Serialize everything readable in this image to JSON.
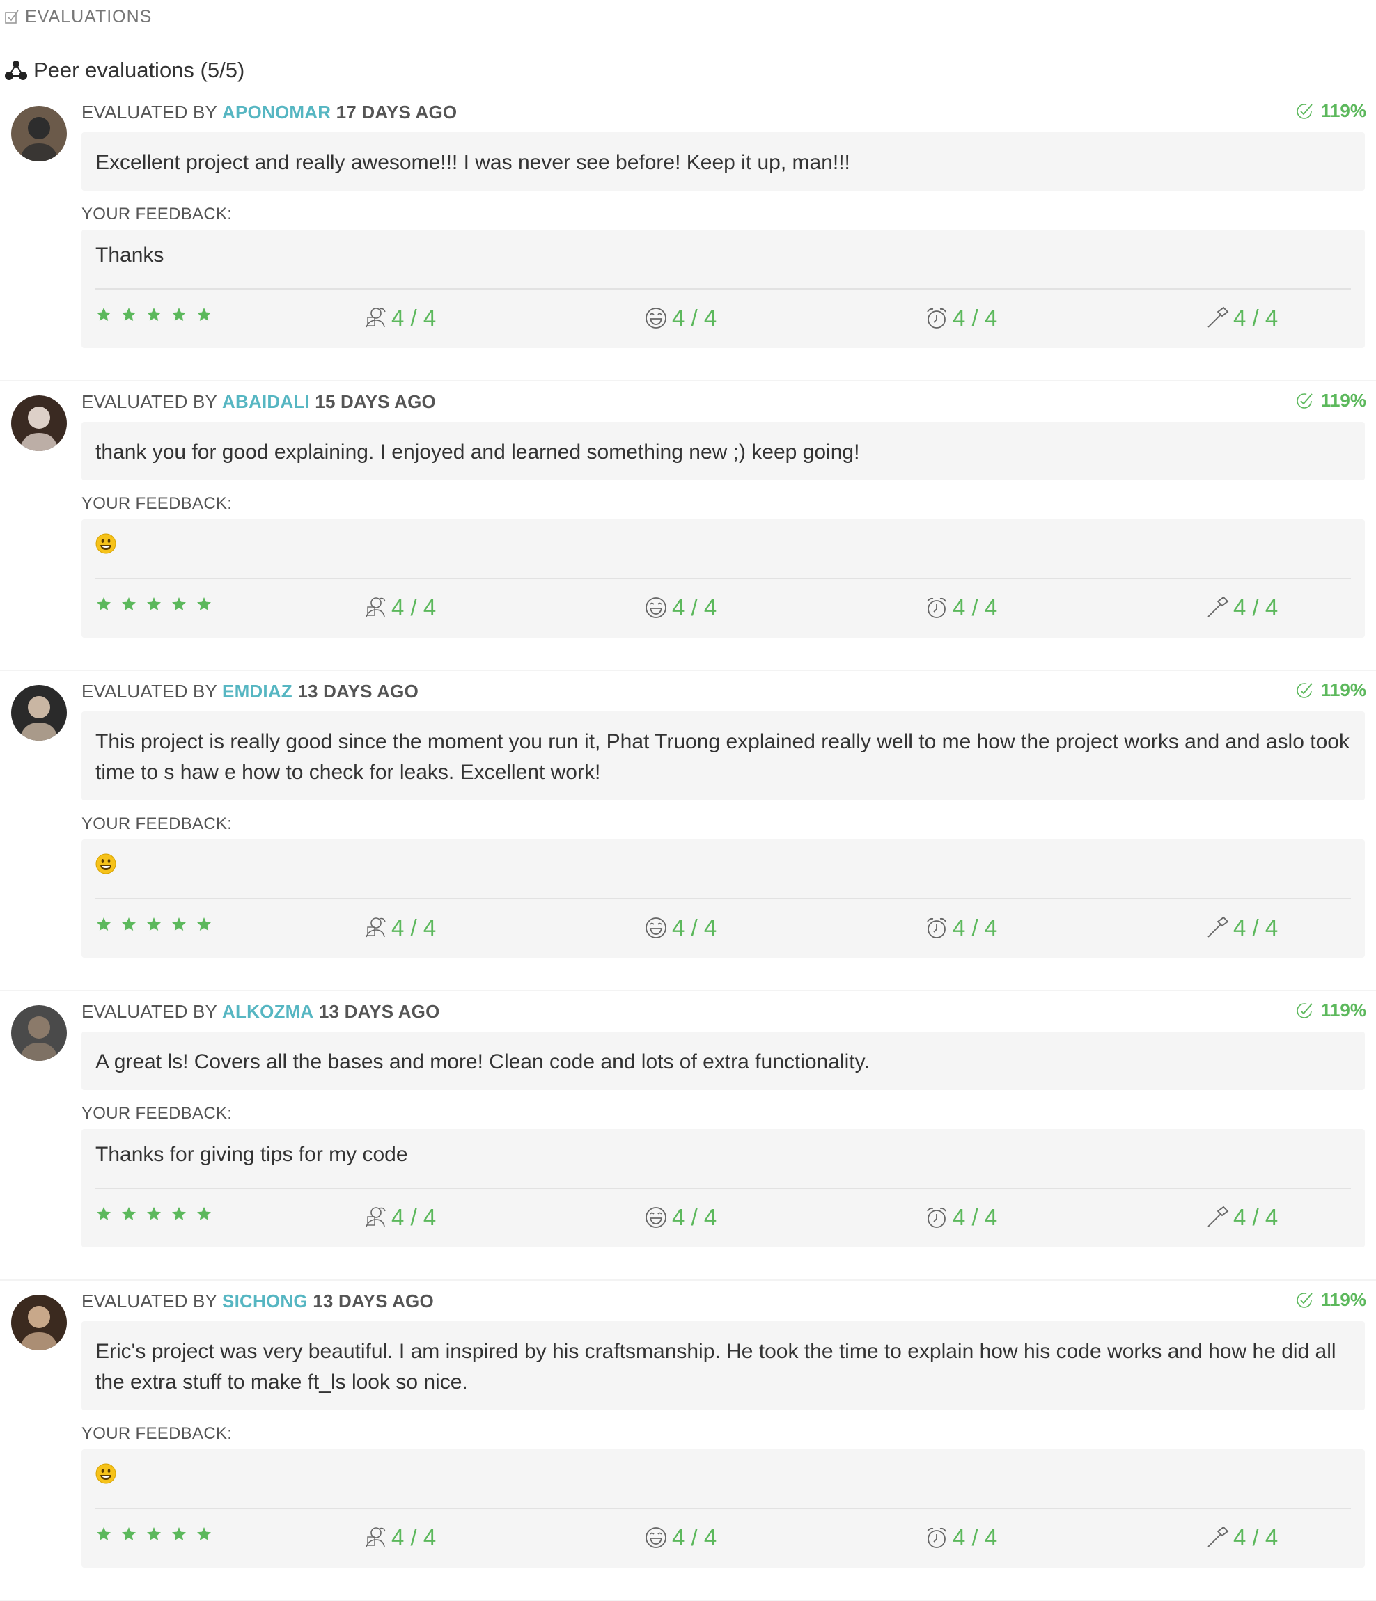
{
  "section": {
    "title": "EVALUATIONS",
    "icon": "checkbox-icon"
  },
  "peer": {
    "title": "Peer evaluations (5/5)",
    "icon": "network-icon"
  },
  "evaluations": [
    {
      "prefix": "EVALUATED BY",
      "login": "APONOMAR",
      "ago": "17 DAYS AGO",
      "score": "119%",
      "comment": "Excellent project and really awesome!!! I was never see before! Keep it up, man!!!",
      "feedback_label": "YOUR FEEDBACK:",
      "feedback": "Thanks",
      "feedback_is_emoji": false,
      "criteria": [
        "4 / 4",
        "4 / 4",
        "4 / 4",
        "4 / 4"
      ]
    },
    {
      "prefix": "EVALUATED BY",
      "login": "ABAIDALI",
      "ago": "15 DAYS AGO",
      "score": "119%",
      "comment": "thank you for good explaining. I enjoyed and learned something new ;) keep going!",
      "feedback_label": "YOUR FEEDBACK:",
      "feedback": "",
      "feedback_is_emoji": true,
      "criteria": [
        "4 / 4",
        "4 / 4",
        "4 / 4",
        "4 / 4"
      ]
    },
    {
      "prefix": "EVALUATED BY",
      "login": "EMDIAZ",
      "ago": "13 DAYS AGO",
      "score": "119%",
      "comment": "This project is really good since the moment you run it, Phat Truong explained really well to me how the project works and and aslo took time to s haw e how to check for leaks. Excellent work!",
      "feedback_label": "YOUR FEEDBACK:",
      "feedback": "",
      "feedback_is_emoji": true,
      "criteria": [
        "4 / 4",
        "4 / 4",
        "4 / 4",
        "4 / 4"
      ]
    },
    {
      "prefix": "EVALUATED BY",
      "login": "ALKOZMA",
      "ago": "13 DAYS AGO",
      "score": "119%",
      "comment": "A great ls! Covers all the bases and more! Clean code and lots of extra functionality.",
      "feedback_label": "YOUR FEEDBACK:",
      "feedback": "Thanks for giving tips for my code",
      "feedback_is_emoji": false,
      "criteria": [
        "4 / 4",
        "4 / 4",
        "4 / 4",
        "4 / 4"
      ]
    },
    {
      "prefix": "EVALUATED BY",
      "login": "SICHONG",
      "ago": "13 DAYS AGO",
      "score": "119%",
      "comment": "Eric's project was very beautiful. I am inspired by his craftsmanship. He took the time to explain how his code works and how he did all the extra stuff to make ft_ls look so nice.",
      "feedback_label": "YOUR FEEDBACK:",
      "feedback": "",
      "feedback_is_emoji": true,
      "criteria": [
        "4 / 4",
        "4 / 4",
        "4 / 4",
        "4 / 4"
      ]
    }
  ],
  "criteria_icons": [
    "evaluator-icon",
    "smiley-icon",
    "alarm-clock-icon",
    "hammer-icon"
  ],
  "stars_count": 5,
  "colors": {
    "accent_green": "#5cb85c",
    "login_teal": "#56b6c2",
    "box_bg": "#f5f5f5"
  }
}
